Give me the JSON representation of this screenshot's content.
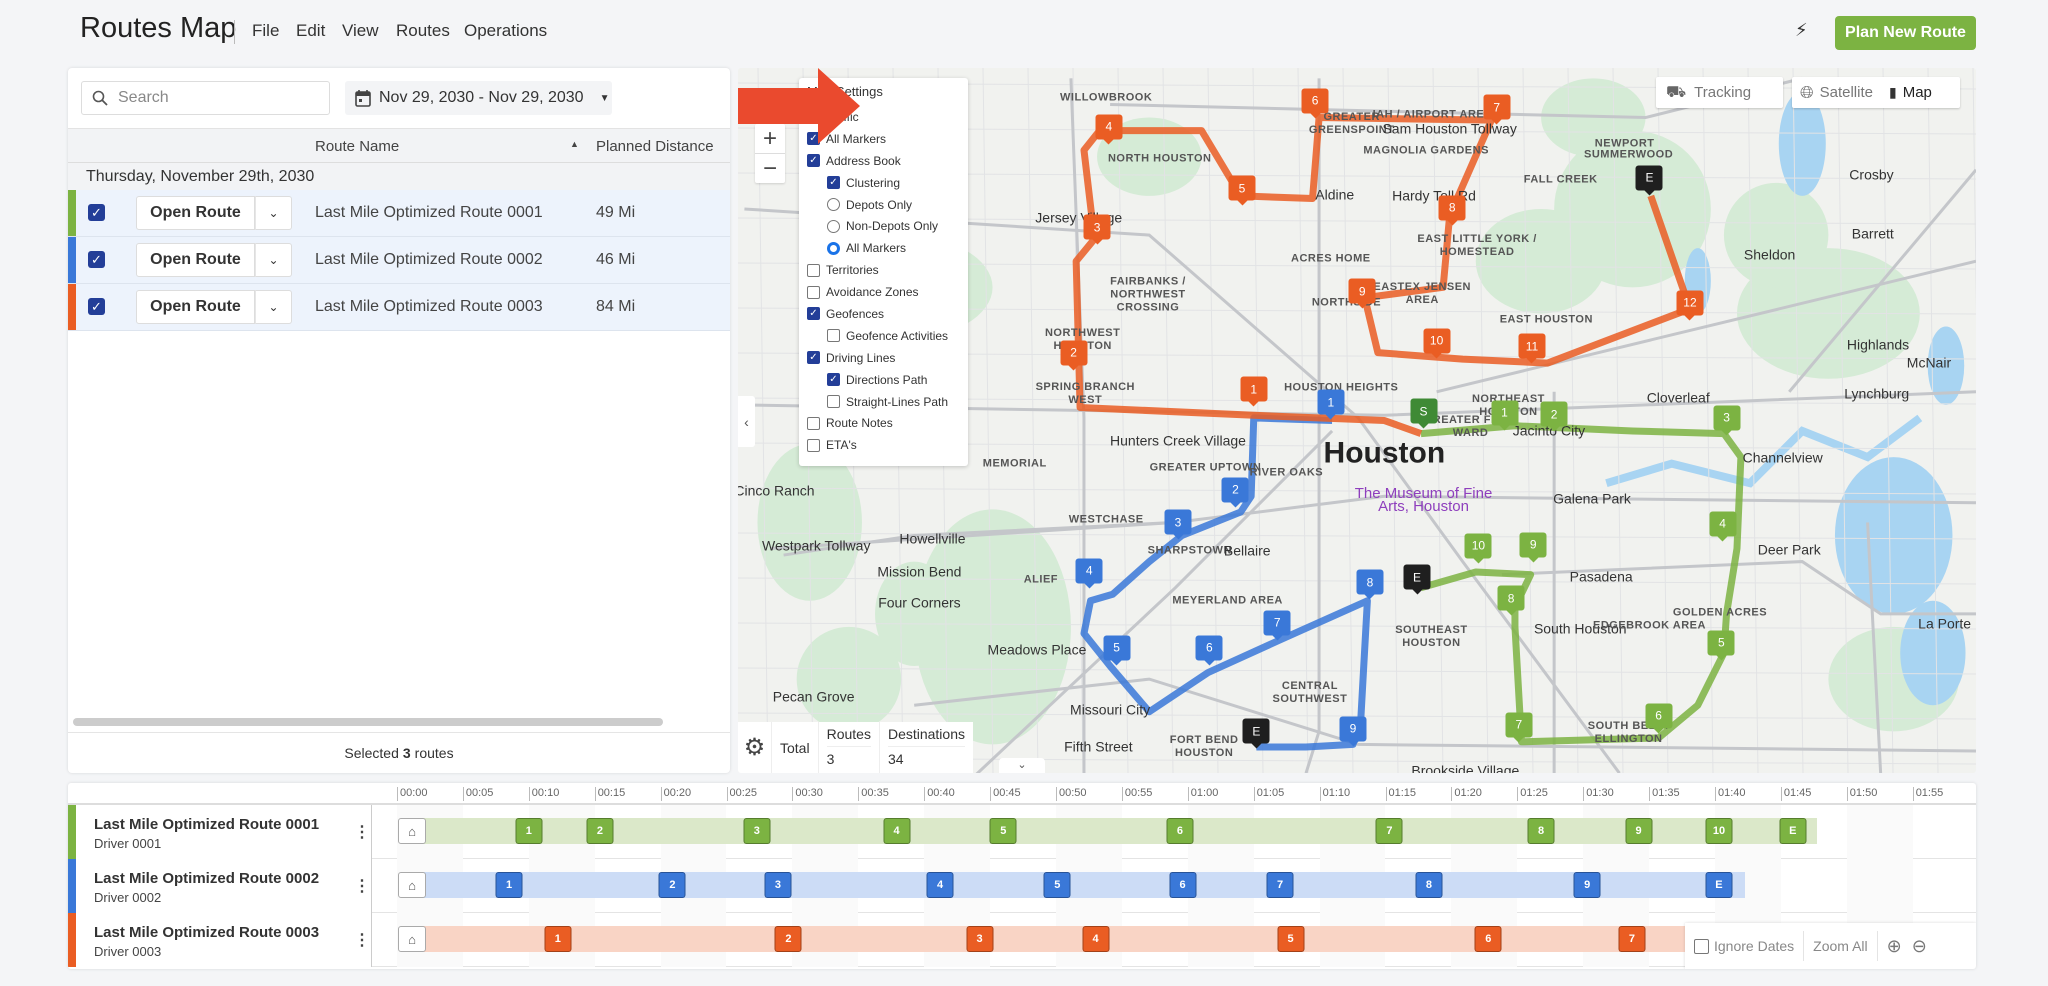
{
  "header": {
    "title": "Routes Map",
    "menu": [
      "File",
      "Edit",
      "View",
      "Routes",
      "Operations"
    ],
    "plan_button": "Plan New Route"
  },
  "colors": {
    "route1": "#7cb342",
    "route2": "#3a78d8",
    "route3": "#ea5d23",
    "start": "#3f8a35",
    "end": "#1f1f1f",
    "accent": "#7cb342"
  },
  "left_panel": {
    "search_placeholder": "Search",
    "date_range": "Nov 29, 2030 - Nov 29, 2030",
    "columns": {
      "route_name": "Route Name",
      "planned_distance": "Planned Distance"
    },
    "group_label": "Thursday, November 29th, 2030",
    "open_label": "Open Route",
    "routes": [
      {
        "name": "Last Mile Optimized Route 0001",
        "distance": "49 Mi",
        "checked": true
      },
      {
        "name": "Last Mile Optimized Route 0002",
        "distance": "46 Mi",
        "checked": true
      },
      {
        "name": "Last Mile Optimized Route 0003",
        "distance": "84 Mi",
        "checked": true
      }
    ],
    "footer": {
      "prefix": "Selected",
      "count": "3",
      "suffix": "routes"
    }
  },
  "map": {
    "settings": {
      "title": "Map Settings",
      "items": [
        {
          "label": "Traffic",
          "type": "checkbox",
          "checked": false,
          "indent": false
        },
        {
          "label": "All Markers",
          "type": "checkbox",
          "checked": true,
          "indent": false
        },
        {
          "label": "Address Book",
          "type": "checkbox",
          "checked": true,
          "indent": false
        },
        {
          "label": "Clustering",
          "type": "checkbox",
          "checked": true,
          "indent": true
        },
        {
          "label": "Depots Only",
          "type": "radio",
          "checked": false,
          "indent": true
        },
        {
          "label": "Non-Depots Only",
          "type": "radio",
          "checked": false,
          "indent": true
        },
        {
          "label": "All Markers",
          "type": "radio",
          "checked": true,
          "indent": true
        },
        {
          "label": "Territories",
          "type": "checkbox",
          "checked": false,
          "indent": false
        },
        {
          "label": "Avoidance Zones",
          "type": "checkbox",
          "checked": false,
          "indent": false
        },
        {
          "label": "Geofences",
          "type": "checkbox",
          "checked": true,
          "indent": false
        },
        {
          "label": "Geofence Activities",
          "type": "checkbox",
          "checked": false,
          "indent": true
        },
        {
          "label": "Driving Lines",
          "type": "checkbox",
          "checked": true,
          "indent": false
        },
        {
          "label": "Directions Path",
          "type": "checkbox",
          "checked": true,
          "indent": true
        },
        {
          "label": "Straight-Lines Path",
          "type": "checkbox",
          "checked": false,
          "indent": true
        },
        {
          "label": "Route Notes",
          "type": "checkbox",
          "checked": false,
          "indent": false
        },
        {
          "label": "ETA's",
          "type": "checkbox",
          "checked": false,
          "indent": false
        }
      ]
    },
    "tracking_label": "Tracking",
    "satellite_label": "Satellite",
    "map_label": "Map",
    "active_map_type": "Map",
    "totals": {
      "label": "Total",
      "routes_header": "Routes",
      "destinations_header": "Destinations",
      "routes": "3",
      "destinations": "34"
    },
    "place_labels": [
      "Houston",
      "WILLOWBROOK",
      "NORTH HOUSTON",
      "Aldine",
      "Jersey Village",
      "ACRES HOME",
      "FAIRBANKS / NORTHWEST CROSSING",
      "NORTHSIDE",
      "NORTHWEST HOUSTON",
      "SPRING BRANCH WEST",
      "MEMORIAL",
      "Hunters Creek Village",
      "HOUSTON HEIGHTS",
      "GREATER UPTOWN",
      "RIVER OAKS",
      "WESTCHASE",
      "SHARPSTOWN",
      "Bellaire",
      "ALIEF",
      "MEYERLAND AREA",
      "Howellville",
      "Mission Bend",
      "Four Corners",
      "Cinco Ranch",
      "Meadows Place",
      "Missouri City",
      "Pecan Grove",
      "Fifth Street",
      "FORT BEND HOUSTON",
      "CENTRAL SOUTHWEST",
      "SOUTHEAST HOUSTON",
      "South Houston",
      "Pasadena",
      "Galena Park",
      "Deer Park",
      "GOLDEN ACRES",
      "EDGEBROOK AREA",
      "SOUTH BELT / ELLINGTON",
      "Brookside Village",
      "La Porte",
      "Jacinto City",
      "Channelview",
      "Cloverleaf",
      "Highlands",
      "Lynchburg",
      "McNair",
      "Sheldon",
      "Barrett",
      "Crosby",
      "NEWPORT",
      "SUMMERWOOD",
      "FALL CREEK",
      "IAH / AIRPORT AREA",
      "MAGNOLIA GARDENS",
      "EAST LITTLE YORK / HOMESTEAD",
      "EASTEX JENSEN AREA",
      "EAST HOUSTON",
      "NORTHEAST HOUSTON",
      "GREATER FIFTH WARD",
      "GREATER GREENSPOINT",
      "The Museum of Fine Arts, Houston",
      "Sam Houston Tollway",
      "Westpark Tollway",
      "Hardy Toll Rd"
    ],
    "routes": [
      {
        "color": "route1",
        "markers": [
          "S",
          "1",
          "2",
          "3",
          "4",
          "5",
          "6",
          "7",
          "8",
          "9",
          "10",
          "E"
        ]
      },
      {
        "color": "route2",
        "markers": [
          "1",
          "2",
          "3",
          "4",
          "5",
          "6",
          "7",
          "8",
          "9",
          "E"
        ]
      },
      {
        "color": "route3",
        "markers": [
          "1",
          "2",
          "3",
          "4",
          "5",
          "6",
          "7",
          "8",
          "9",
          "10",
          "11",
          "12",
          "E"
        ]
      }
    ]
  },
  "timeline": {
    "ticks": [
      "00:00",
      "00:05",
      "00:10",
      "00:15",
      "00:20",
      "00:25",
      "00:30",
      "00:35",
      "00:40",
      "00:45",
      "00:50",
      "00:55",
      "01:00",
      "01:05",
      "01:10",
      "01:15",
      "01:20",
      "01:25",
      "01:30",
      "01:35",
      "01:40",
      "01:45",
      "01:50",
      "01:55"
    ],
    "rows": [
      {
        "name": "Last Mile Optimized Route 0001",
        "driver": "Driver 0001",
        "color": "route1",
        "bar_color": "#dbe8c9",
        "end_minute": 107,
        "stops": [
          {
            "label": "1",
            "minute": 10
          },
          {
            "label": "2",
            "minute": 15.4
          },
          {
            "label": "3",
            "minute": 27.3
          },
          {
            "label": "4",
            "minute": 37.9
          },
          {
            "label": "5",
            "minute": 46
          },
          {
            "label": "6",
            "minute": 59.4
          },
          {
            "label": "7",
            "minute": 75.3
          },
          {
            "label": "8",
            "minute": 86.8
          },
          {
            "label": "9",
            "minute": 94.2
          },
          {
            "label": "10",
            "minute": 100.3
          },
          {
            "label": "E",
            "minute": 105.9
          }
        ]
      },
      {
        "name": "Last Mile Optimized Route 0002",
        "driver": "Driver 0002",
        "color": "route2",
        "bar_color": "#ccdcf6",
        "end_minute": 101.5,
        "stops": [
          {
            "label": "1",
            "minute": 8.5
          },
          {
            "label": "2",
            "minute": 20.9
          },
          {
            "label": "3",
            "minute": 28.9
          },
          {
            "label": "4",
            "minute": 41.2
          },
          {
            "label": "5",
            "minute": 50.1
          },
          {
            "label": "6",
            "minute": 59.6
          },
          {
            "label": "7",
            "minute": 67
          },
          {
            "label": "8",
            "minute": 78.3
          },
          {
            "label": "9",
            "minute": 90.3
          },
          {
            "label": "E",
            "minute": 100.3
          }
        ]
      },
      {
        "name": "Last Mile Optimized Route 0003",
        "driver": "Driver 0003",
        "color": "route3",
        "bar_color": "#f9d4c5",
        "end_minute": 125,
        "stops": [
          {
            "label": "1",
            "minute": 12.2
          },
          {
            "label": "2",
            "minute": 29.7
          },
          {
            "label": "3",
            "minute": 44.2
          },
          {
            "label": "4",
            "minute": 53
          },
          {
            "label": "5",
            "minute": 67.8
          },
          {
            "label": "6",
            "minute": 82.8
          },
          {
            "label": "7",
            "minute": 93.7
          }
        ]
      }
    ],
    "tools": {
      "ignore_dates": "Ignore Dates",
      "zoom_all": "Zoom All"
    }
  }
}
